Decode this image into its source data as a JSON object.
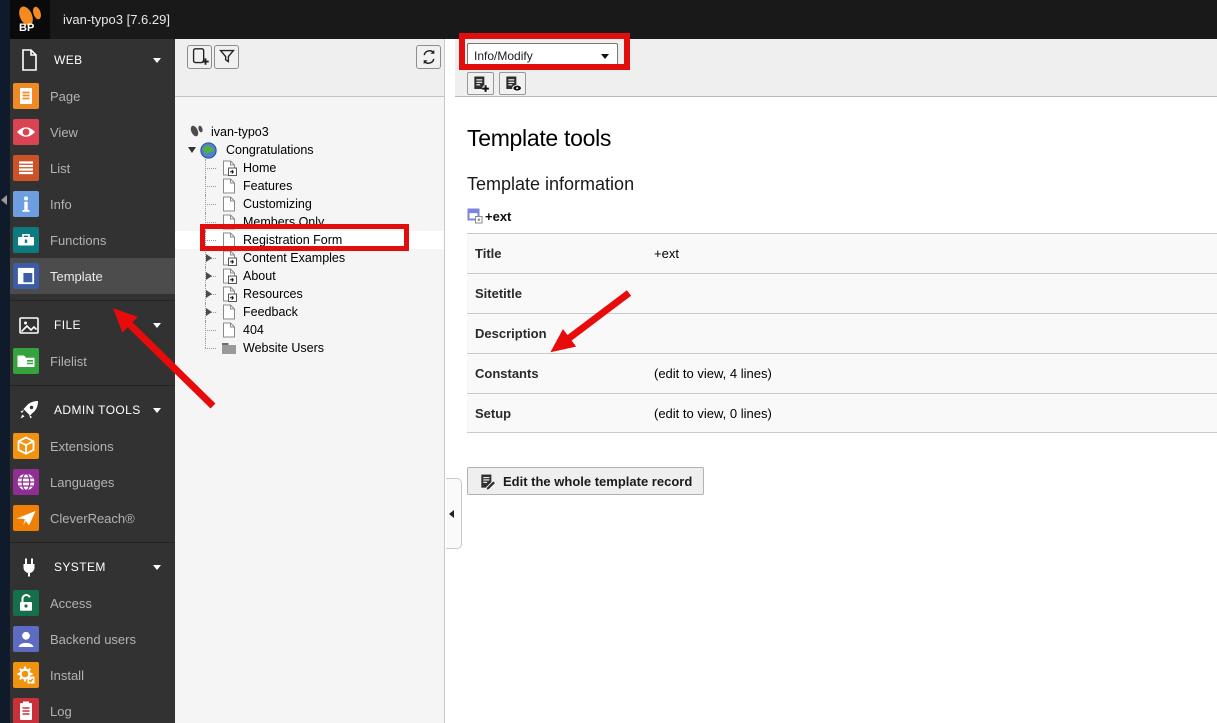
{
  "topbar": {
    "site_title": "ivan-typo3 [7.6.29]",
    "logo_text": "BP"
  },
  "module_menu": {
    "sections": [
      {
        "label": "WEB",
        "icon": "document-icon",
        "items": [
          {
            "label": "Page",
            "color": "#f08a24"
          },
          {
            "label": "View",
            "color": "#d94352"
          },
          {
            "label": "List",
            "color": "#cb5327"
          },
          {
            "label": "Info",
            "color": "#6d9fe0"
          },
          {
            "label": "Functions",
            "color": "#0b7b80"
          },
          {
            "label": "Template",
            "color": "#3d5ca6",
            "selected": true
          }
        ]
      },
      {
        "label": "FILE",
        "icon": "image-icon",
        "items": [
          {
            "label": "Filelist",
            "color": "#34a33e"
          }
        ]
      },
      {
        "label": "ADMIN TOOLS",
        "icon": "rocket-icon",
        "items": [
          {
            "label": "Extensions",
            "color": "#f1930f"
          },
          {
            "label": "Languages",
            "color": "#8f2f93"
          },
          {
            "label": "CleverReach®",
            "color": "#f07f05"
          }
        ]
      },
      {
        "label": "SYSTEM",
        "icon": "plug-icon",
        "items": [
          {
            "label": "Access",
            "color": "#156f4b"
          },
          {
            "label": "Backend users",
            "color": "#5d6bc0"
          },
          {
            "label": "Install",
            "color": "#f1930f"
          },
          {
            "label": "Log",
            "color": "#c8303a"
          }
        ]
      }
    ]
  },
  "page_tree": {
    "nodes": [
      {
        "label": "ivan-typo3",
        "depth": 0,
        "icon": "typo3-logo"
      },
      {
        "label": "Congratulations",
        "depth": 1,
        "icon": "globe",
        "expanded": true
      },
      {
        "label": "Home",
        "depth": 2,
        "icon": "page-shortcut"
      },
      {
        "label": "Features",
        "depth": 2,
        "icon": "page"
      },
      {
        "label": "Customizing",
        "depth": 2,
        "icon": "page"
      },
      {
        "label": "Members Only",
        "depth": 2,
        "icon": "page"
      },
      {
        "label": "Registration Form",
        "depth": 2,
        "icon": "page",
        "selected": true
      },
      {
        "label": "Content Examples",
        "depth": 2,
        "icon": "page-shortcut",
        "collapsed": true
      },
      {
        "label": "About",
        "depth": 2,
        "icon": "page-shortcut",
        "collapsed": true
      },
      {
        "label": "Resources",
        "depth": 2,
        "icon": "page-shortcut",
        "collapsed": true
      },
      {
        "label": "Feedback",
        "depth": 2,
        "icon": "page",
        "collapsed": true
      },
      {
        "label": "404",
        "depth": 2,
        "icon": "page"
      },
      {
        "label": "Website Users",
        "depth": 2,
        "icon": "folder"
      }
    ]
  },
  "content": {
    "docheader": {
      "function_select_value": "Info/Modify"
    },
    "title": "Template tools",
    "section_title": "Template information",
    "record_name": "+ext",
    "table": {
      "rows": [
        {
          "label": "Title",
          "value": "+ext"
        },
        {
          "label": "Sitetitle",
          "value": ""
        },
        {
          "label": "Description",
          "value": ""
        },
        {
          "label": "Constants",
          "value": "(edit to view, 4 lines)"
        },
        {
          "label": "Setup",
          "value": "(edit to view, 0 lines)"
        }
      ]
    },
    "edit_button_label": "Edit the whole template record"
  },
  "annotations": {
    "highlight_color": "#e20d0d"
  }
}
